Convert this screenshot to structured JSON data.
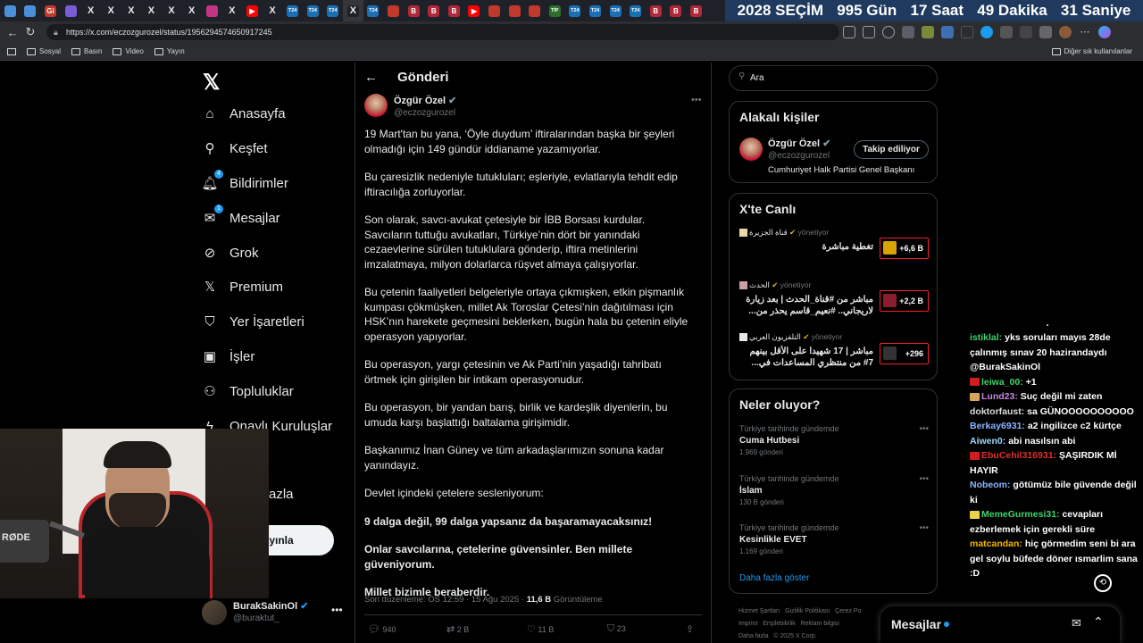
{
  "browser": {
    "tabs": [
      {
        "label": "",
        "color": "#4a90d9"
      },
      {
        "label": "",
        "color": "#4a90d9"
      },
      {
        "label": "Gi",
        "color": "#c0392b"
      },
      {
        "label": "",
        "color": "#7b5cd6"
      },
      {
        "label": "X",
        "color": "#1f2128"
      },
      {
        "label": "X",
        "color": "#1f2128"
      },
      {
        "label": "X",
        "color": "#1f2128"
      },
      {
        "label": "X",
        "color": "#1f2128"
      },
      {
        "label": "X",
        "color": "#1f2128"
      },
      {
        "label": "X",
        "color": "#1f2128"
      },
      {
        "label": "",
        "color": "#c13584"
      },
      {
        "label": "X",
        "color": "#1f2128"
      },
      {
        "label": "▶",
        "color": "#ff0000"
      },
      {
        "label": "X",
        "color": "#1f2128"
      },
      {
        "label": "T24",
        "color": "#1b6fb3"
      },
      {
        "label": "T24",
        "color": "#1b6fb3"
      },
      {
        "label": "T24",
        "color": "#1b6fb3"
      },
      {
        "label": "X",
        "color": "#1f2128"
      },
      {
        "label": "T24",
        "color": "#1b6fb3"
      },
      {
        "label": "",
        "color": "#c0392b"
      },
      {
        "label": "B",
        "color": "#b0283a"
      },
      {
        "label": "B",
        "color": "#b0283a"
      },
      {
        "label": "B",
        "color": "#b0283a"
      },
      {
        "label": "▶",
        "color": "#ff0000"
      },
      {
        "label": "",
        "color": "#c0392b"
      },
      {
        "label": "",
        "color": "#c0392b"
      },
      {
        "label": "",
        "color": "#c0392b"
      },
      {
        "label": "TİP",
        "color": "#2c6e2c"
      },
      {
        "label": "T24",
        "color": "#1b6fb3"
      },
      {
        "label": "T24",
        "color": "#1b6fb3"
      },
      {
        "label": "T24",
        "color": "#1b6fb3"
      },
      {
        "label": "T24",
        "color": "#1b6fb3"
      },
      {
        "label": "B",
        "color": "#b0283a"
      },
      {
        "label": "B",
        "color": "#b0283a"
      },
      {
        "label": "B",
        "color": "#b0283a"
      }
    ],
    "countdown": {
      "year": "2028",
      "label": "SEÇİM",
      "days": "995",
      "days_unit": "Gün",
      "hours": "17",
      "hours_unit": "Saat",
      "minutes": "49",
      "minutes_unit": "Dakika",
      "seconds": "31",
      "seconds_unit": "Saniye"
    },
    "url": "https://x.com/eczozgurozel/status/1956294574650917245",
    "bookmarks": [
      "Sosyal",
      "Basın",
      "Video",
      "Yayın"
    ],
    "other_bookmarks": "Diğer sık kullanılanlar"
  },
  "nav": {
    "items": [
      {
        "label": "Anasayfa",
        "icon": "home-icon"
      },
      {
        "label": "Keşfet",
        "icon": "search-icon"
      },
      {
        "label": "Bildirimler",
        "icon": "bell-icon",
        "badge": "4"
      },
      {
        "label": "Mesajlar",
        "icon": "mail-icon",
        "badge": "1"
      },
      {
        "label": "Grok",
        "icon": "grok-icon"
      },
      {
        "label": "Premium",
        "icon": "x-icon"
      },
      {
        "label": "Yer İşaretleri",
        "icon": "bookmark-icon"
      },
      {
        "label": "İşler",
        "icon": "briefcase-icon"
      },
      {
        "label": "Topluluklar",
        "icon": "people-icon"
      },
      {
        "label": "Onaylı Kuruluşlar",
        "icon": "lightning-icon"
      }
    ],
    "more_partial": "azla",
    "post_button_partial": "yayınla",
    "account": {
      "name": "BurakSakinOl",
      "handle": "@buraktut_"
    }
  },
  "post": {
    "header_title": "Gönderi",
    "author": "Özgür Özel",
    "handle": "@eczozgurozel",
    "paragraphs": [
      "19 Mart'tan bu yana, ‘Öyle duydum’ iftiralarından başka bir şeyleri olmadığı için 149 gündür iddianame yazamıyorlar.",
      "Bu çaresizlik nedeniyle tutukluları; eşleriyle, evlatlarıyla tehdit edip iftiracılığa zorluyorlar.",
      "Son olarak, savcı-avukat çetesiyle bir İBB Borsası kurdular. Savcıların tuttuğu avukatları, Türkiye’nin dört bir yanındaki cezaevlerine sürülen tutuklulara gönderip, iftira metinlerini imzalatmaya, milyon dolarlarca rüşvet almaya çalışıyorlar.",
      "Bu çetenin faaliyetleri belgeleriyle ortaya çıkmışken, etkin pişmanlık kumpası çökmüşken, millet Ak Toroslar Çetesi’nin dağıtılması için HSK’nın harekete geçmesini beklerken, bugün hala bu çetenin eliyle operasyon yapıyorlar.",
      "Bu operasyon, yargı çetesinin ve Ak Parti’nin yaşadığı tahribatı örtmek için girişilen bir intikam operasyonudur.",
      "Bu operasyon, bir yandan barış, birlik ve kardeşlik diyenlerin, bu umuda karşı başlattığı baltalama girişimidir.",
      "Başkanımız İnan Güney ve tüm arkadaşlarımızın sonuna kadar yanındayız.",
      "Devlet içindeki çetelere sesleniyorum:"
    ],
    "bold_paragraphs": [
      "9 dalga değil, 99 dalga yapsanız da başaramayacaksınız!",
      "Onlar savcılarına, çetelerine güvensinler. Ben millete güveniyorum.",
      "Millet bizimle beraberdir."
    ],
    "meta_edited": "Son düzenleme: ÖS 12:59 · 15 Ağu 2025 ·",
    "meta_views": "11,6 B",
    "meta_views_label": "Görüntüleme",
    "actions": {
      "replies": "940",
      "reposts": "2 B",
      "likes": "11 B",
      "bookmarks": "23"
    }
  },
  "right": {
    "search_placeholder": "Ara",
    "related_title": "Alakalı kişiler",
    "related": {
      "name": "Özgür Özel",
      "handle": "@eczozgurozel",
      "bio": "Cumhuriyet Halk Partisi Genel Başkanı",
      "follow_label": "Takip ediliyor"
    },
    "live_title": "X'te Canlı",
    "live": [
      {
        "source": "قناة الجزيرة",
        "status": "yönetiyor",
        "title": "تغطية مباشرة",
        "count": "+6,6 B"
      },
      {
        "source": "الحدث",
        "status": "yönetiyor",
        "title": "مباشر من #قناة_الحدث | بعد زيارة لاريجاني.. #نعيم_قاسم يحذر من...",
        "count": "+2,2 B"
      },
      {
        "source": "التلفزيون العربي",
        "status": "yönetiyor",
        "title": "مباشر | 17 شهيدا على الأقل بينهم 7# من منتظري المساعدات في...",
        "count": "+296"
      }
    ],
    "trends_title": "Neler oluyor?",
    "trends": [
      {
        "context": "Türkiye tarihinde gündemde",
        "title": "Cuma Hutbesi",
        "count": "1.969 gönderi"
      },
      {
        "context": "Türkiye tarihinde gündemde",
        "title": "İslam",
        "count": "130 B gönderi"
      },
      {
        "context": "Türkiye tarihinde gündemde",
        "title": "Kesinlikle EVET",
        "count": "1.169 gönderi"
      }
    ],
    "show_more": "Daha fazla göster",
    "footer": [
      "Hizmet Şartları",
      "Gizlilik Politikası",
      "Çerez Po",
      "Imprint",
      "Erişilebilirlik",
      "Reklam bilgisi",
      "Daha fazla",
      "© 2025 X Corp."
    ],
    "messages_label": "Mesajlar"
  },
  "chat": [
    {
      "user": "",
      "text": "•",
      "color": "#ffffff"
    },
    {
      "user": "istiklal:",
      "text": "yks soruları mayıs 28de çalınmış sınav 20 hazirandaydı @BurakSakinOl",
      "color": "#3fd26b"
    },
    {
      "user": "leiwa_00:",
      "text": "+1",
      "color": "#3fd26b",
      "icon": "#d11d1d"
    },
    {
      "user": "Lund23:",
      "text": "Suç değil mi zaten",
      "color": "#c38ae0",
      "icon": "#d9a35a"
    },
    {
      "user": "doktorfaust:",
      "text": "sa GÜNOOOOOOOOOO",
      "color": "#dcdcdc"
    },
    {
      "user": "Berkay6931:",
      "text": "a2 ingilizce c2 kürtçe",
      "color": "#8cb4ff"
    },
    {
      "user": "Aiwen0:",
      "text": "abi nasılsın abi",
      "color": "#9dd8ff"
    },
    {
      "user": "EbuCehil316931:",
      "text": "ŞAŞIRDIK Mİ HAYIR",
      "color": "#e02e2e",
      "icon": "#d11d1d"
    },
    {
      "user": "Nobeom:",
      "text": "götümüz bile güvende değil ki",
      "color": "#8cb4ff"
    },
    {
      "user": "MemeGurmesi31:",
      "text": "cevapları ezberlemek için gerekli süre",
      "color": "#3fd26b",
      "icon": "#e7d24b"
    },
    {
      "user": "matcandan:",
      "text": "hiç görmedim seni bi ara gel soylu büfede döner ısmarlim sana :D",
      "color": "#f0b400"
    }
  ],
  "stream_overlay": {
    "mic_brand": "RØDE"
  }
}
